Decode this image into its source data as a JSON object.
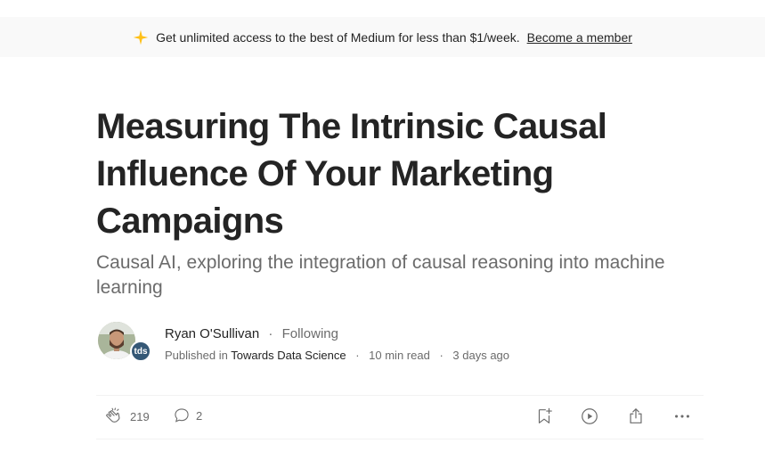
{
  "banner": {
    "icon": "sparkle-icon",
    "message": "Get unlimited access to the best of Medium for less than $1/week.",
    "cta": "Become a member",
    "star_color": "#FFC017"
  },
  "article": {
    "title": "Measuring The Intrinsic Causal Influence Of Your Marketing Campaigns",
    "subtitle": "Causal AI, exploring the integration of causal reasoning into machine learning"
  },
  "author": {
    "name": "Ryan O'Sullivan",
    "separator": "·",
    "follow_status": "Following",
    "published_prefix": "Published in",
    "publication": "Towards Data Science",
    "publication_badge": "tds",
    "read_time": "10 min read",
    "date": "3 days ago"
  },
  "actions": {
    "claps": "219",
    "responses": "2",
    "icons": [
      "clap-icon",
      "comment-icon",
      "bookmark-add-icon",
      "play-icon",
      "share-icon",
      "more-icon"
    ]
  }
}
